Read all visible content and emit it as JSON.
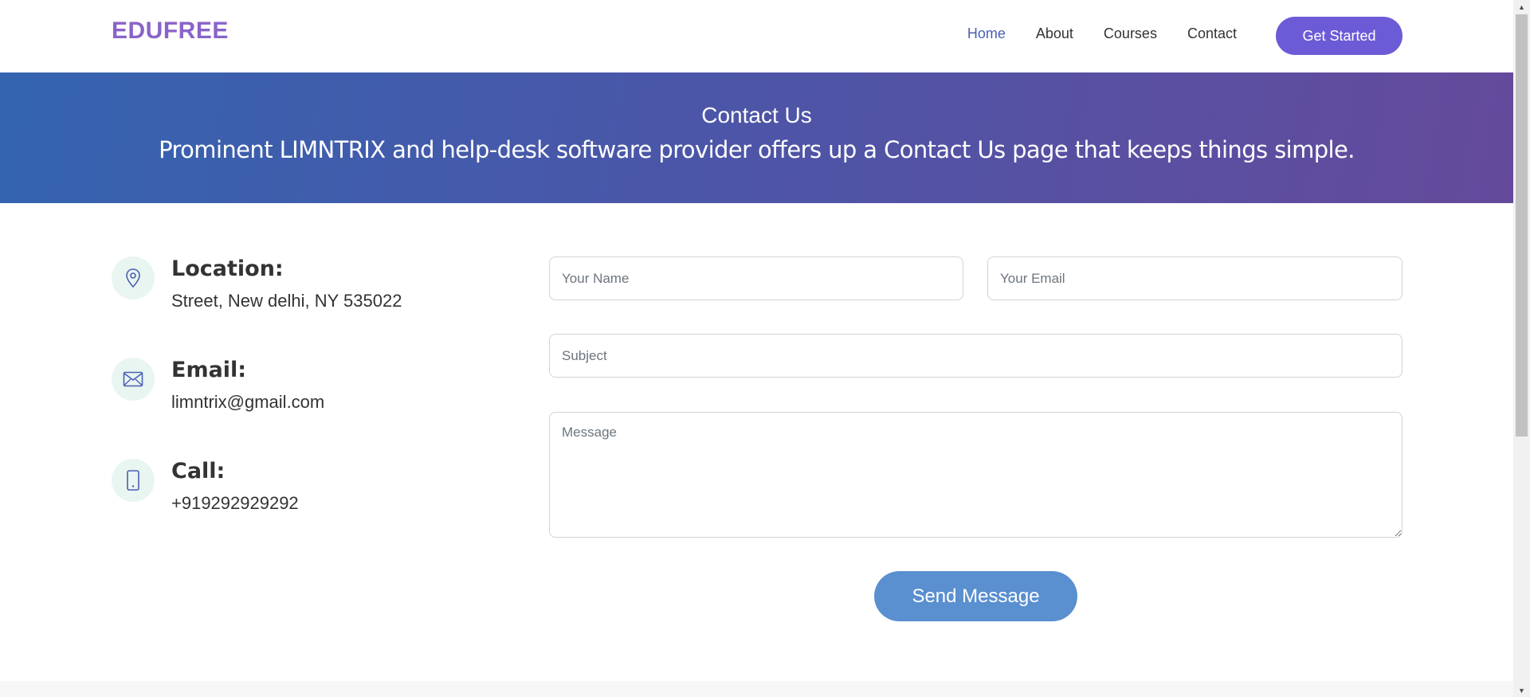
{
  "header": {
    "logo": "EDUFREE",
    "nav": [
      {
        "label": "Home",
        "active": true
      },
      {
        "label": "About",
        "active": false
      },
      {
        "label": "Courses",
        "active": false
      },
      {
        "label": "Contact",
        "active": false
      }
    ],
    "cta_label": "Get Started"
  },
  "hero": {
    "title": "Contact Us",
    "subtitle": "Prominent LIMNTRIX and help-desk software provider offers up a Contact Us page that keeps things simple."
  },
  "contact_info": {
    "location": {
      "title": "Location:",
      "value": "Street, New delhi, NY 535022",
      "icon": "map-pin-icon"
    },
    "email": {
      "title": "Email:",
      "value": "limntrix@gmail.com",
      "icon": "envelope-icon"
    },
    "call": {
      "title": "Call:",
      "value": "+919292929292",
      "icon": "phone-icon"
    }
  },
  "form": {
    "name_placeholder": "Your Name",
    "email_placeholder": "Your Email",
    "subject_placeholder": "Subject",
    "message_placeholder": "Message",
    "send_label": "Send Message"
  },
  "colors": {
    "brand": "#8a63c9",
    "accent": "#6c5bd6",
    "nav_active": "#4a5fb3",
    "hero_gradient_start": "#3464b0",
    "hero_gradient_end": "#654a9b",
    "send_button": "#5a8fd0",
    "icon_bg": "#e9f5f0"
  }
}
